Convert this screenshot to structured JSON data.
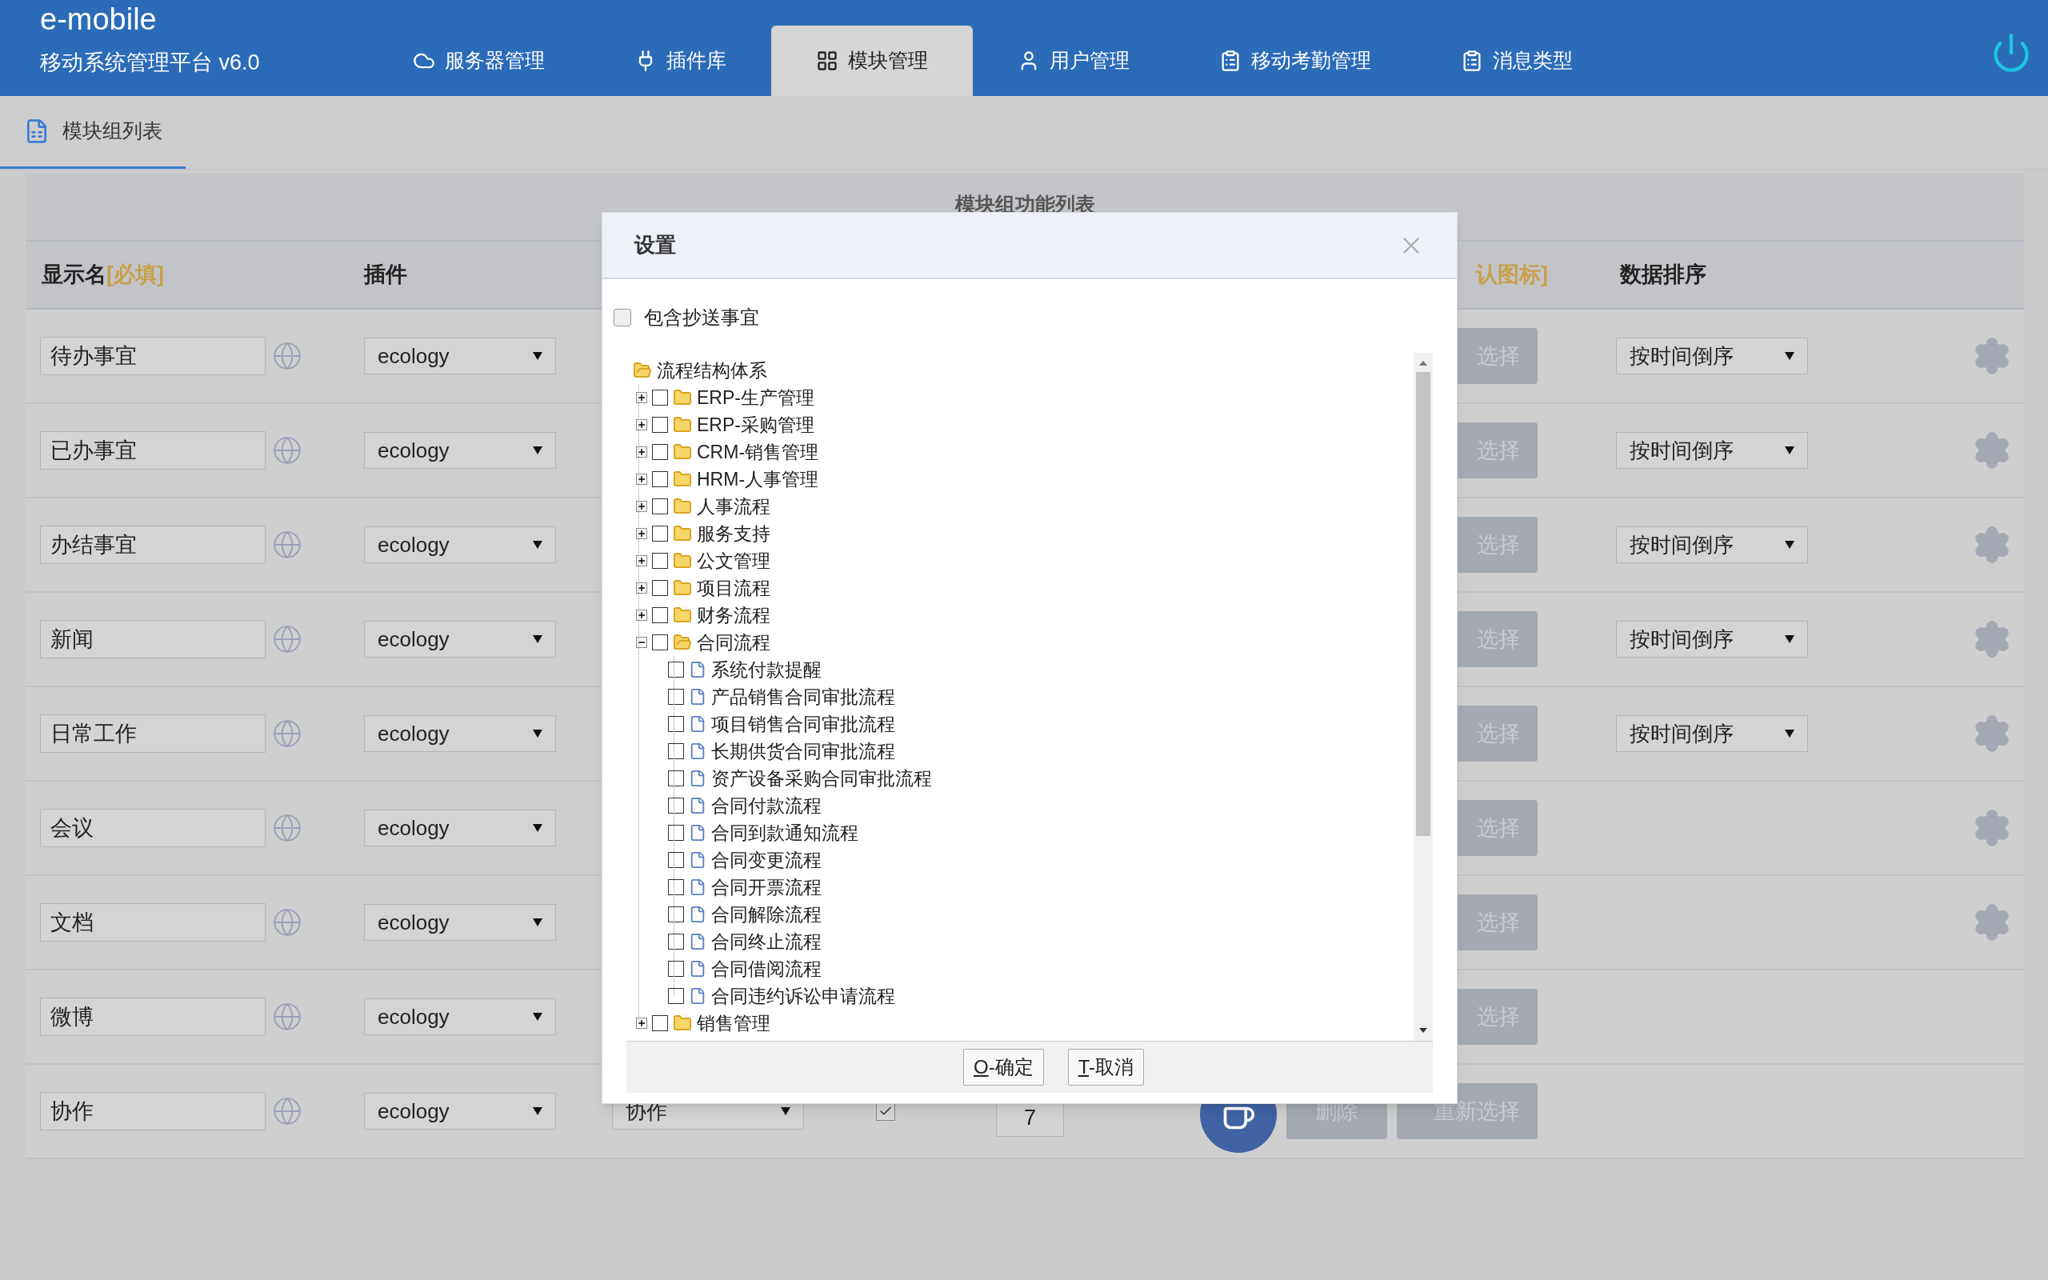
{
  "brand": {
    "logo": "e-mobile",
    "subtitle": "移动系统管理平台 v6.0"
  },
  "nav_tabs": [
    {
      "label": "服务器管理",
      "selected": false
    },
    {
      "label": "插件库",
      "selected": false
    },
    {
      "label": "模块管理",
      "selected": true
    },
    {
      "label": "用户管理",
      "selected": false
    },
    {
      "label": "移动考勤管理",
      "selected": false
    },
    {
      "label": "消息类型",
      "selected": false
    }
  ],
  "sub_tabs": [
    {
      "label": "模块组列表",
      "selected": true
    }
  ],
  "table": {
    "title": "模块组功能列表",
    "columns": [
      {
        "label": "显示名",
        "note": "[必填]"
      },
      {
        "label": "插件"
      },
      {
        "note": "认图标]"
      },
      {
        "label": "数据排序"
      }
    ],
    "rows": [
      {
        "name": "待办事宜",
        "plugin": "ecology",
        "reselect": "选择",
        "sort": "按时间倒序",
        "settings": true
      },
      {
        "name": "已办事宜",
        "plugin": "ecology",
        "reselect": "选择",
        "sort": "按时间倒序",
        "settings": true
      },
      {
        "name": "办结事宜",
        "plugin": "ecology",
        "reselect": "选择",
        "sort": "按时间倒序",
        "settings": true
      },
      {
        "name": "新闻",
        "plugin": "ecology",
        "reselect": "选择",
        "sort": "按时间倒序",
        "settings": true
      },
      {
        "name": "日常工作",
        "plugin": "ecology",
        "reselect": "选择",
        "sort": "按时间倒序",
        "settings": true
      },
      {
        "name": "会议",
        "plugin": "ecology",
        "reselect": "选择",
        "settings": true
      },
      {
        "name": "文档",
        "plugin": "ecology",
        "reselect": "选择",
        "settings": true
      },
      {
        "name": "微博",
        "plugin": "ecology",
        "reselect": "选择",
        "settings": false
      },
      {
        "name": "协作",
        "plugin": "ecology",
        "category": "协作",
        "checked": true,
        "order": "7",
        "delete": "删除",
        "reselect": "重新选择",
        "settings": false
      }
    ]
  },
  "dialog": {
    "title": "设置",
    "include_cc": {
      "label": "包含抄送事宜",
      "checked": false
    },
    "tree": {
      "label": "流程结构体系",
      "expanded": true,
      "children": [
        {
          "kind": "folder",
          "label": "ERP-生产管理",
          "checked": false,
          "expanded": false
        },
        {
          "kind": "folder",
          "label": "ERP-采购管理",
          "checked": false,
          "expanded": false
        },
        {
          "kind": "folder",
          "label": "CRM-销售管理",
          "checked": false,
          "expanded": false
        },
        {
          "kind": "folder",
          "label": "HRM-人事管理",
          "checked": false,
          "expanded": false
        },
        {
          "kind": "folder",
          "label": "人事流程",
          "checked": false,
          "expanded": false
        },
        {
          "kind": "folder",
          "label": "服务支持",
          "checked": false,
          "expanded": false
        },
        {
          "kind": "folder",
          "label": "公文管理",
          "checked": false,
          "expanded": false
        },
        {
          "kind": "folder",
          "label": "项目流程",
          "checked": false,
          "expanded": false
        },
        {
          "kind": "folder",
          "label": "财务流程",
          "checked": false,
          "expanded": false
        },
        {
          "kind": "folder",
          "label": "合同流程",
          "checked": false,
          "expanded": true,
          "children": [
            {
              "kind": "file",
              "label": "系统付款提醒",
              "checked": false
            },
            {
              "kind": "file",
              "label": "产品销售合同审批流程",
              "checked": false
            },
            {
              "kind": "file",
              "label": "项目销售合同审批流程",
              "checked": false
            },
            {
              "kind": "file",
              "label": "长期供货合同审批流程",
              "checked": false
            },
            {
              "kind": "file",
              "label": "资产设备采购合同审批流程",
              "checked": false
            },
            {
              "kind": "file",
              "label": "合同付款流程",
              "checked": false
            },
            {
              "kind": "file",
              "label": "合同到款通知流程",
              "checked": false
            },
            {
              "kind": "file",
              "label": "合同变更流程",
              "checked": false
            },
            {
              "kind": "file",
              "label": "合同开票流程",
              "checked": false
            },
            {
              "kind": "file",
              "label": "合同解除流程",
              "checked": false
            },
            {
              "kind": "file",
              "label": "合同终止流程",
              "checked": false
            },
            {
              "kind": "file",
              "label": "合同借阅流程",
              "checked": false
            },
            {
              "kind": "file",
              "label": "合同违约诉讼申请流程",
              "checked": false
            }
          ]
        },
        {
          "kind": "folder",
          "label": "销售管理",
          "checked": false,
          "expanded": false
        }
      ]
    },
    "buttons": [
      {
        "key": "O",
        "label": "-确定"
      },
      {
        "key": "T",
        "label": "-取消"
      }
    ]
  }
}
